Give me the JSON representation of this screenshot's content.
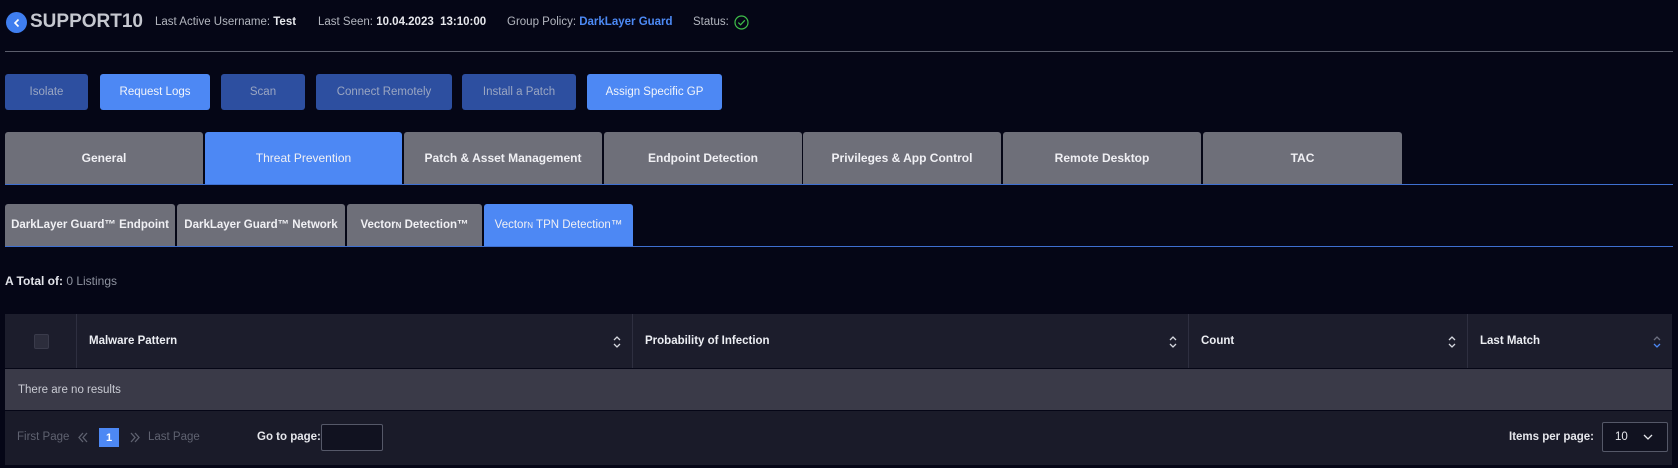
{
  "header": {
    "hostname": "SUPPORT10",
    "last_active_label": "Last Active Username:",
    "last_active_value": "Test",
    "last_seen_label": "Last Seen:",
    "last_seen_date": "10.04.2023",
    "last_seen_time": "13:10:00",
    "group_policy_label": "Group Policy:",
    "group_policy_value": "DarkLayer Guard",
    "status_label": "Status:"
  },
  "actions": [
    "Isolate",
    "Request Logs",
    "Scan",
    "Connect Remotely",
    "Install a Patch",
    "Assign Specific GP"
  ],
  "tabs": [
    "General",
    "Threat Prevention",
    "Patch & Asset Management",
    "Endpoint Detection",
    "Privileges & App Control",
    "Remote Desktop",
    "TAC"
  ],
  "subtabs": {
    "endpoint": "DarkLayer Guard™ Endpoint",
    "network": "DarkLayer Guard™ Network",
    "vector_prefix": "Vector",
    "vector_sup": "N",
    "vector_suffix": " Detection™",
    "tpn_prefix": "Vector",
    "tpn_sup": "N",
    "tpn_suffix": " TPN Detection™"
  },
  "total": {
    "label": "A Total of:",
    "count": "0 Listings"
  },
  "table": {
    "columns": [
      "Malware Pattern",
      "Probability of Infection",
      "Count",
      "Last Match"
    ],
    "empty_message": "There are no results"
  },
  "pagination": {
    "first": "First Page",
    "last": "Last Page",
    "current_page": "1",
    "go_to_label": "Go to page:",
    "go_to_value": "",
    "items_per_page_label": "Items per page:",
    "items_per_page_value": "10"
  },
  "colors": {
    "accent": "#4d88f4",
    "background": "#050616",
    "status_ok": "#3fbf4a"
  }
}
